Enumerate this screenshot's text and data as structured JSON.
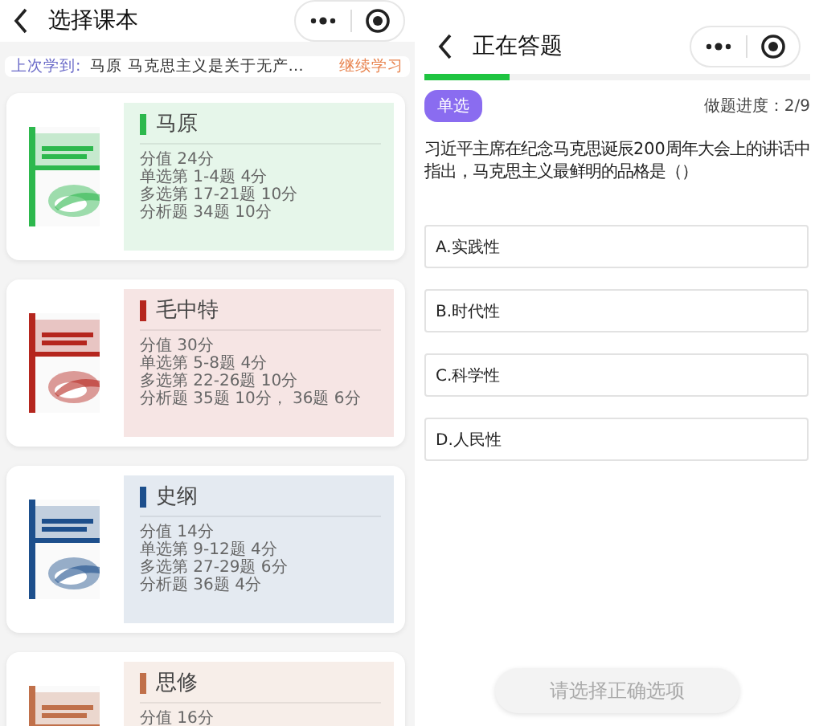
{
  "left_screen": {
    "title": "选择课本",
    "last_study": {
      "label": "上次学到:",
      "text": "马原 马克思主义是关于无产…",
      "action": "继续学习"
    },
    "books": [
      {
        "name": "马原",
        "color": "#2db84d",
        "lines": [
          "分值 24分",
          "单选第 1-4题 4分",
          "多选第 17-21题 10分",
          "分析题 34题 10分"
        ]
      },
      {
        "name": "毛中特",
        "color": "#b5261e",
        "lines": [
          "分值 30分",
          "单选第 5-8题 4分",
          "多选第 22-26题 10分",
          "分析题 35题 10分， 36题 6分"
        ]
      },
      {
        "name": "史纲",
        "color": "#1d4f8c",
        "lines": [
          "分值 14分",
          "单选第 9-12题 4分",
          "多选第 27-29题 6分",
          "分析题 36题 4分"
        ]
      },
      {
        "name": "思修",
        "color": "#c0704a",
        "lines": [
          "分值 16分"
        ]
      }
    ]
  },
  "right_screen": {
    "title": "正在答题",
    "progress": {
      "level": 0.22
    },
    "question_type": "单选",
    "progress_text": "做题进度：2/9",
    "question": "习近平主席在纪念马克思诞辰200周年大会上的讲话中指出，马克思主义最鲜明的品格是（）",
    "options": [
      {
        "label": "A.实践性",
        "selected": false
      },
      {
        "label": "B.时代性",
        "selected": false
      },
      {
        "label": "C.科学性",
        "selected": false
      },
      {
        "label": "D.人民性",
        "selected": false
      }
    ],
    "submit": {
      "label": "请选择正确选项",
      "disabled": true
    }
  }
}
